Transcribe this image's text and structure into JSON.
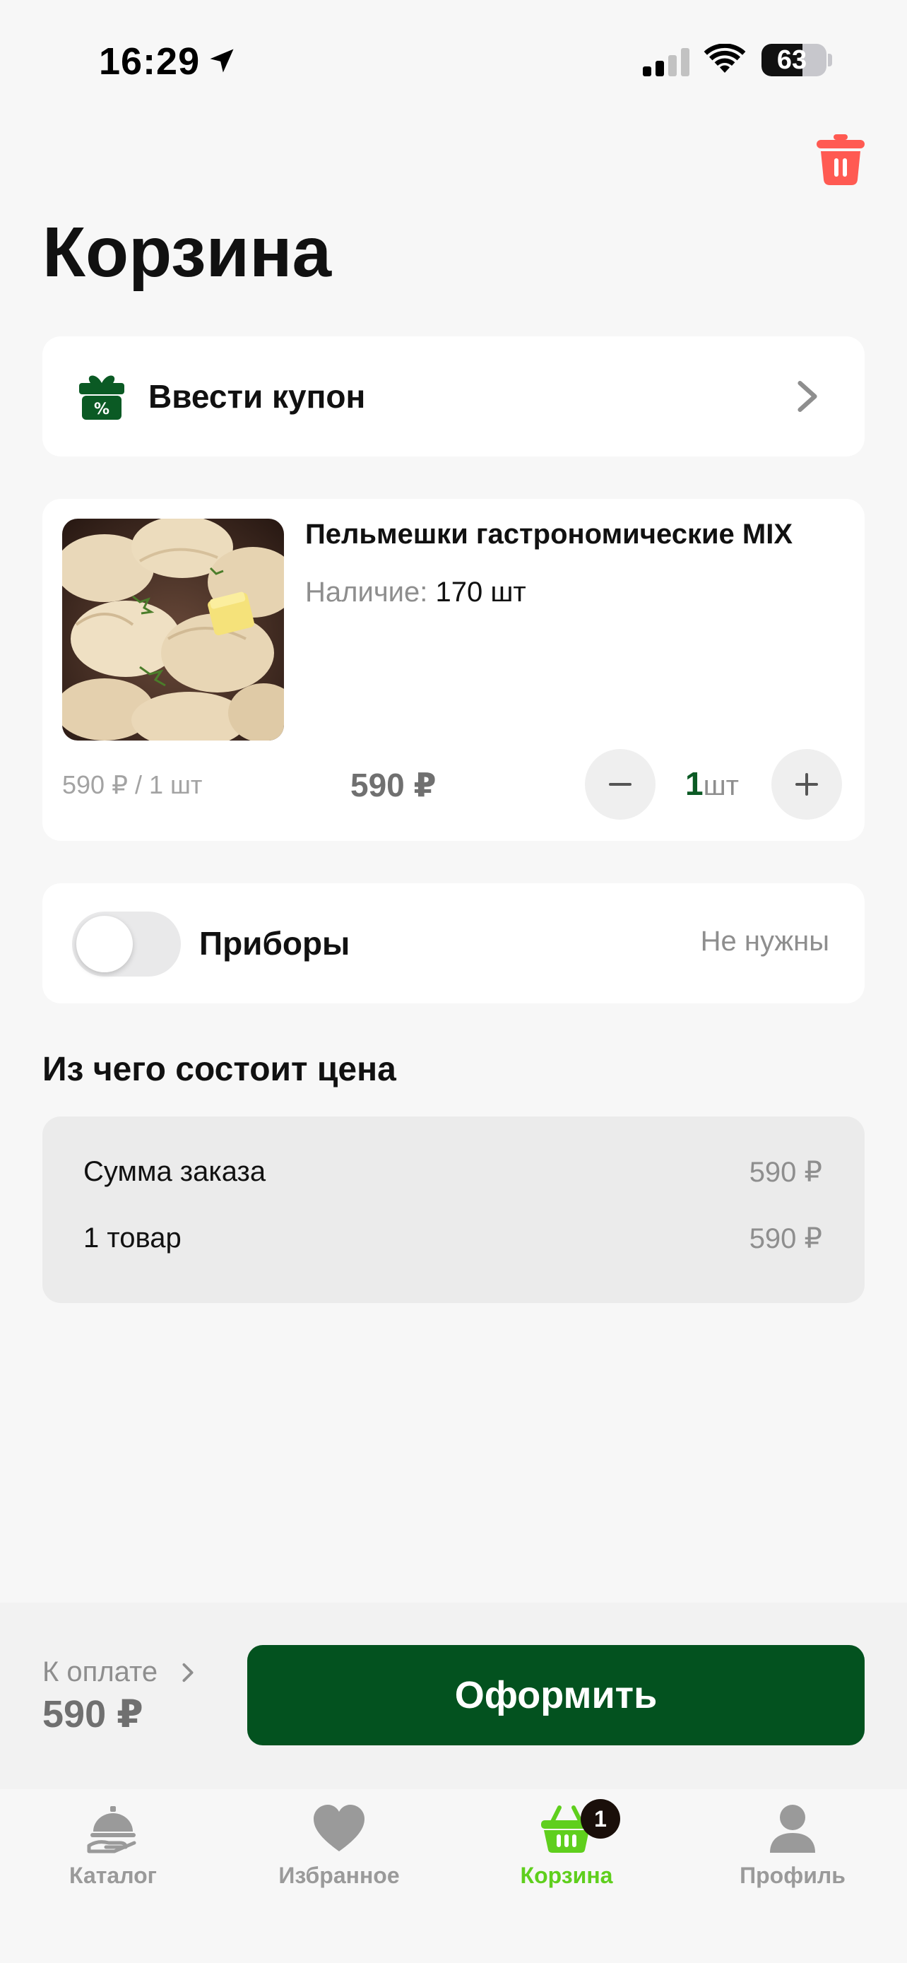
{
  "status_bar": {
    "time": "16:29",
    "battery": "63",
    "battery_fraction": 0.63
  },
  "header": {
    "title": "Корзина",
    "trash_icon": "trash-icon"
  },
  "coupon": {
    "label": "Ввести купон",
    "icon": "gift-icon"
  },
  "product": {
    "name": "Пельмешки гастрономические MIX",
    "stock_label": "Наличие:",
    "stock_value": "170 шт",
    "unit_price": "590 ₽ / 1 шт",
    "line_total": "590 ₽",
    "quantity": "1",
    "quantity_unit": "шт"
  },
  "cutlery": {
    "label": "Приборы",
    "value": "Не нужны",
    "enabled": false
  },
  "price_breakdown": {
    "heading": "Из чего состоит цена",
    "rows": [
      {
        "label": "Сумма заказа",
        "value": "590 ₽"
      },
      {
        "label": "1 товар",
        "value": "590 ₽"
      }
    ]
  },
  "checkout": {
    "pay_label": "К оплате",
    "pay_amount": "590 ₽",
    "button_label": "Оформить"
  },
  "tab_bar": {
    "items": [
      {
        "label": "Каталог",
        "icon": "cloche-icon"
      },
      {
        "label": "Избранное",
        "icon": "heart-icon"
      },
      {
        "label": "Корзина",
        "icon": "basket-icon",
        "badge": "1",
        "active": true
      },
      {
        "label": "Профиль",
        "icon": "person-icon"
      }
    ]
  },
  "colors": {
    "brand_green": "#03521f",
    "active_tab": "#5fcf1d",
    "trash_red": "#ff5a52"
  }
}
